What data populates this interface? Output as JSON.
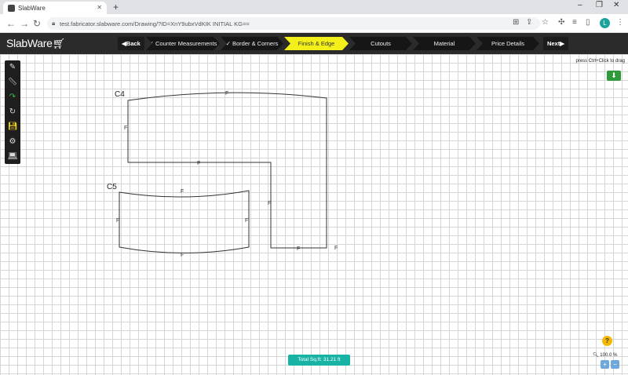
{
  "browser": {
    "tab_title": "SlabWare",
    "tab_close": "✕",
    "new_tab": "+",
    "url": "test.fabricator.slabware.com/Drawing/?ID=XnY9ubxVdKIK INITIAL KG==",
    "window_controls": [
      "–",
      "❐",
      "✕"
    ],
    "profile_initial": "L"
  },
  "app": {
    "logo": "SlabWare",
    "back_label": "Back",
    "next_label": "Next",
    "steps": [
      {
        "label": "Counter Measurements",
        "check": true
      },
      {
        "label": "Border & Corners",
        "check": true
      },
      {
        "label": "Finish & Edge",
        "check": false,
        "active": true
      },
      {
        "label": "Cutouts",
        "check": false
      },
      {
        "label": "Material",
        "check": false
      },
      {
        "label": "Price Details",
        "check": false
      }
    ],
    "colors": {
      "active_step": "#f2ef1a",
      "total_button": "#18b3a5",
      "download": "#2e9a3a"
    }
  },
  "toolbar": {
    "tools": [
      "pencil-icon",
      "ruler-icon",
      "redo-icon",
      "refresh-icon",
      "save-icon",
      "gear-icon",
      "laptop-icon"
    ]
  },
  "canvas": {
    "hint": "press Ctrl+Click to drag",
    "zoom_label": "100.0 %",
    "total_button": "Total Sq.ft: 31.21 ft",
    "help": "?",
    "pieces": [
      {
        "name": "C4",
        "edge_label": "F"
      },
      {
        "name": "C5",
        "edge_label": "F"
      }
    ]
  }
}
